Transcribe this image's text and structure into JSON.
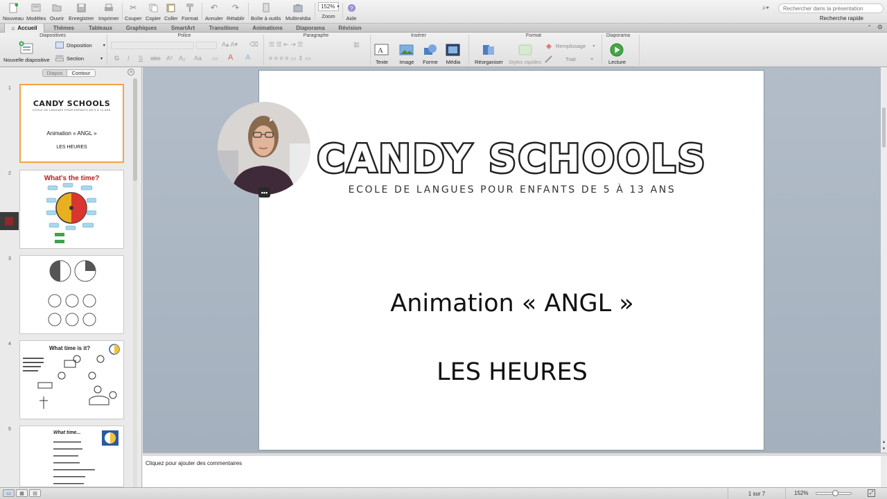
{
  "toolbar": {
    "buttons": [
      {
        "label": "Nouveau",
        "icon": "new-file-icon"
      },
      {
        "label": "Modèles",
        "icon": "templates-icon"
      },
      {
        "label": "Ouvrir",
        "icon": "open-folder-icon"
      },
      {
        "label": "Enregistrer",
        "icon": "save-icon"
      },
      {
        "label": "Imprimer",
        "icon": "print-icon"
      },
      {
        "label": "Couper",
        "icon": "scissors-icon"
      },
      {
        "label": "Copier",
        "icon": "copy-icon"
      },
      {
        "label": "Coller",
        "icon": "paste-icon"
      },
      {
        "label": "Format",
        "icon": "format-brush-icon"
      },
      {
        "label": "Annuler",
        "icon": "undo-icon"
      },
      {
        "label": "Rétablir",
        "icon": "redo-icon"
      },
      {
        "label": "Boîte à outils",
        "icon": "toolbox-icon"
      },
      {
        "label": "Multimédia",
        "icon": "media-browser-icon"
      },
      {
        "label": "Zoom",
        "icon": "zoom-box"
      },
      {
        "label": "Aide",
        "icon": "help-icon"
      }
    ],
    "zoom_value": "152%",
    "search_placeholder": "Rechercher dans la présentation",
    "quick_search": "Recherche rapide"
  },
  "ribbon_tabs": [
    "Accueil",
    "Thèmes",
    "Tableaux",
    "Graphiques",
    "SmartArt",
    "Transitions",
    "Animations",
    "Diaporama",
    "Révision"
  ],
  "ribbon": {
    "groups": {
      "diapositives": "Diapositives",
      "police": "Police",
      "paragraphe": "Paragraphe",
      "inserer": "Insérer",
      "format": "Format",
      "diaporama": "Diaporama"
    },
    "nouvelle_diapositive": "Nouvelle diapositive",
    "disposition": "Disposition",
    "section": "Section",
    "texte": "Texte",
    "image": "Image",
    "forme": "Forme",
    "media": "Média",
    "reorganiser": "Réorganiser",
    "styles_rapides": "Styles rapides",
    "remplissage": "Remplissage",
    "trait": "Trait",
    "lecture": "Lecture"
  },
  "pane": {
    "tab_diapos": "Diapos",
    "tab_contour": "Contour"
  },
  "slides": [
    {
      "num": "1",
      "title": "CANDY SCHOOLS",
      "subtitle": "ECOLE DE LANGUES POUR ENFANTS DE 5 À 13 ANS",
      "line1": "Animation «  ANGL »",
      "line2": "LES HEURES"
    },
    {
      "num": "2",
      "title": "What's the time?"
    },
    {
      "num": "3"
    },
    {
      "num": "4",
      "title": "What time is it?"
    },
    {
      "num": "5",
      "title": "What time..."
    }
  ],
  "main_slide": {
    "title": "CANDY SCHOOLS",
    "subtitle": "ECOLE DE LANGUES POUR ENFANTS DE 5 À 13 ANS",
    "line1": "Animation «  ANGL »",
    "line2": "LES HEURES"
  },
  "notes_placeholder": "Cliquez pour ajouter des commentaires",
  "status": {
    "page": "1 sur 7",
    "zoom": "152%",
    "zoom_fraction": 0.55
  },
  "colors": {
    "selection": "#f3a344",
    "canvas": "#aab5c2",
    "accent_green": "#3aa648"
  }
}
